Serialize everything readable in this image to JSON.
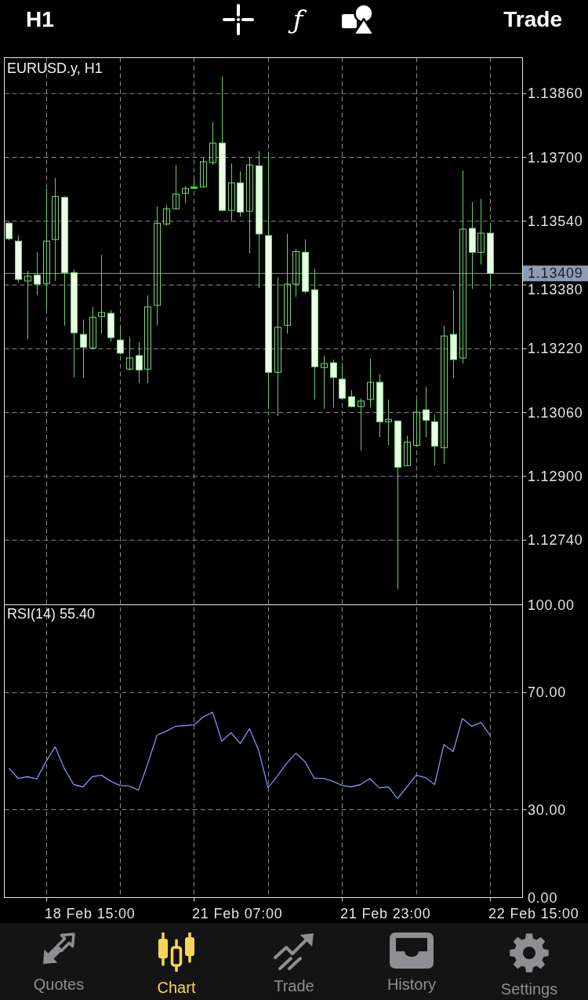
{
  "toolbar": {
    "timeframe": "H1",
    "indicator_glyph": "ƒ",
    "action": "Trade"
  },
  "chart": {
    "chart_data": {
      "type": "candlestick",
      "title": "EURUSD.y, H1",
      "categories": [
        null,
        null,
        null,
        null,
        null,
        null,
        null,
        null,
        null,
        null,
        null,
        null,
        null,
        null,
        null,
        null,
        null,
        null,
        null,
        null,
        null,
        null,
        null,
        null,
        null,
        null,
        null,
        null,
        null,
        null,
        null,
        null,
        null,
        null,
        null,
        null,
        null,
        null,
        null,
        null,
        null,
        null,
        null,
        null,
        null,
        null,
        null,
        null,
        null,
        null,
        null,
        null,
        null,
        null,
        null,
        null
      ],
      "ylim": [
        1.12578,
        1.1395
      ],
      "yticks": [
        {
          "value": 1.1386,
          "label": "1.13860"
        },
        {
          "value": 1.137,
          "label": "1.13700"
        },
        {
          "value": 1.1354,
          "label": "1.13540"
        },
        {
          "value": 1.1338,
          "label": "1.13380"
        },
        {
          "value": 1.1322,
          "label": "1.13220"
        },
        {
          "value": 1.1306,
          "label": "1.13060"
        },
        {
          "value": 1.129,
          "label": "1.12900"
        },
        {
          "value": 1.1274,
          "label": "1.12740"
        }
      ],
      "ohlc": [
        [
          1.13535,
          1.13539,
          1.13492,
          1.13496
        ],
        [
          1.1349,
          1.13504,
          1.13386,
          1.13394
        ],
        [
          1.1339,
          1.13415,
          1.13244,
          1.13402
        ],
        [
          1.13405,
          1.13462,
          1.13354,
          1.13382
        ],
        [
          1.13384,
          1.13622,
          1.13317,
          1.1349
        ],
        [
          1.13494,
          1.13648,
          1.1339,
          1.13602
        ],
        [
          1.136,
          1.13602,
          1.13278,
          1.13411
        ],
        [
          1.13411,
          1.13419,
          1.13148,
          1.1326
        ],
        [
          1.13256,
          1.13293,
          1.13146,
          1.13224
        ],
        [
          1.13222,
          1.13325,
          1.13218,
          1.13299
        ],
        [
          1.13301,
          1.13455,
          1.13258,
          1.13311
        ],
        [
          1.13309,
          1.13317,
          1.13238,
          1.13248
        ],
        [
          1.13242,
          1.13278,
          1.13205,
          1.13209
        ],
        [
          1.13169,
          1.1325,
          1.13165,
          1.13197
        ],
        [
          1.13203,
          1.13236,
          1.13134,
          1.13167
        ],
        [
          1.13169,
          1.13354,
          1.13134,
          1.13325
        ],
        [
          1.13329,
          1.13577,
          1.13279,
          1.13535
        ],
        [
          1.13533,
          1.13581,
          1.13529,
          1.13571
        ],
        [
          1.13571,
          1.13681,
          1.13569,
          1.13608
        ],
        [
          1.1361,
          1.13628,
          1.13585,
          1.13622
        ],
        [
          1.13626,
          1.13644,
          1.1362,
          1.13626
        ],
        [
          1.13626,
          1.13699,
          1.13626,
          1.13689
        ],
        [
          1.13687,
          1.13789,
          1.13681,
          1.13736
        ],
        [
          1.13736,
          1.13903,
          1.13565,
          1.13567
        ],
        [
          1.13567,
          1.13685,
          1.13539,
          1.13636
        ],
        [
          1.13636,
          1.13665,
          1.13551,
          1.13563
        ],
        [
          1.13565,
          1.13701,
          1.13459,
          1.13681
        ],
        [
          1.13679,
          1.13716,
          1.13372,
          1.13508
        ],
        [
          1.13504,
          1.13714,
          1.13069,
          1.13161
        ],
        [
          1.13161,
          1.134,
          1.13051,
          1.13274
        ],
        [
          1.13279,
          1.13508,
          1.13258,
          1.13382
        ],
        [
          1.13382,
          1.1347,
          1.1335,
          1.13464
        ],
        [
          1.13462,
          1.13494,
          1.13358,
          1.13364
        ],
        [
          1.13368,
          1.13421,
          1.13093,
          1.13175
        ],
        [
          1.13173,
          1.13203,
          1.13069,
          1.13183
        ],
        [
          1.13185,
          1.13193,
          1.13073,
          1.13148
        ],
        [
          1.13144,
          1.13185,
          1.13091,
          1.13096
        ],
        [
          1.131,
          1.13116,
          1.13073,
          1.13075
        ],
        [
          1.13075,
          1.13096,
          1.12965,
          1.13089
        ],
        [
          1.13093,
          1.13195,
          1.13073,
          1.13136
        ],
        [
          1.13136,
          1.13157,
          1.12998,
          1.13037
        ],
        [
          1.13037,
          1.13093,
          1.12978,
          1.13043
        ],
        [
          1.13039,
          1.13039,
          1.12618,
          1.12923
        ],
        [
          1.12927,
          1.13002,
          1.12927,
          1.12986
        ],
        [
          1.12978,
          1.13093,
          1.12974,
          1.13061
        ],
        [
          1.13067,
          1.13124,
          1.12998,
          1.13041
        ],
        [
          1.13037,
          1.13055,
          1.12927,
          1.12976
        ],
        [
          1.12972,
          1.13278,
          1.12931,
          1.13252
        ],
        [
          1.13256,
          1.13368,
          1.13146,
          1.13193
        ],
        [
          1.13197,
          1.13667,
          1.13183,
          1.1352
        ],
        [
          1.13522,
          1.13588,
          1.1337,
          1.13462
        ],
        [
          1.13462,
          1.13596,
          1.13431,
          1.1351
        ],
        [
          1.1351,
          1.13533,
          1.13372,
          1.13409
        ],
        null,
        null,
        null
      ],
      "ref_lines": [
        {
          "axis": "y",
          "value": 1.13409,
          "label": "1.13409"
        }
      ]
    }
  },
  "indicator": {
    "chart_data": {
      "type": "line",
      "title": "RSI(14) 55.40",
      "categories": [
        null,
        null,
        null,
        null,
        null,
        null,
        null,
        null,
        null,
        null,
        null,
        null,
        null,
        null,
        null,
        null,
        null,
        null,
        null,
        null,
        null,
        null,
        null,
        null,
        null,
        null,
        null,
        null,
        null,
        null,
        null,
        null,
        null,
        null,
        null,
        null,
        null,
        null,
        null,
        null,
        null,
        null,
        null,
        null,
        null,
        null,
        null,
        null,
        null,
        null,
        null,
        null,
        null,
        null,
        null,
        null
      ],
      "ylim": [
        0,
        100
      ],
      "yticks": [
        {
          "value": 100,
          "label": "100.00"
        },
        {
          "value": 70,
          "label": "70.00"
        },
        {
          "value": 30,
          "label": "30.00"
        },
        {
          "value": 0,
          "label": "0.00"
        }
      ],
      "series": [
        {
          "color": "#7a96e6",
          "values": [
            44.2,
            40.7,
            41.3,
            40.5,
            46.4,
            51.5,
            44.0,
            38.6,
            37.8,
            41.3,
            41.8,
            39.7,
            38.3,
            38.1,
            36.7,
            45.8,
            55.5,
            56.8,
            58.5,
            58.7,
            59.0,
            61.7,
            63.3,
            53.4,
            56.3,
            52.6,
            57.7,
            50.1,
            37.5,
            41.5,
            45.8,
            49.3,
            46.4,
            40.7,
            40.7,
            39.7,
            38.3,
            37.8,
            38.6,
            40.7,
            37.5,
            37.8,
            33.8,
            37.8,
            41.8,
            41.0,
            38.6,
            52.3,
            49.9,
            61.1,
            58.5,
            59.8,
            55.4,
            null,
            null,
            null
          ]
        }
      ]
    }
  },
  "time_axis": {
    "labels": [
      "18 Feb 15:00",
      "21 Feb 07:00",
      "21 Feb 23:00",
      "22 Feb 15:00"
    ]
  },
  "tabs": [
    {
      "label": "Quotes",
      "selected": false
    },
    {
      "label": "Chart",
      "selected": true
    },
    {
      "label": "Trade",
      "selected": false
    },
    {
      "label": "History",
      "selected": false
    },
    {
      "label": "Settings",
      "selected": false
    }
  ]
}
